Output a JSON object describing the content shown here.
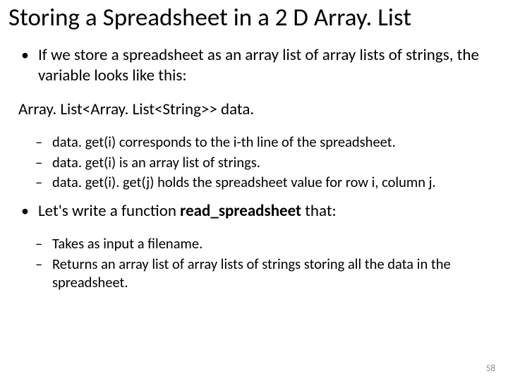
{
  "title": "Storing a Spreadsheet in a 2 D Array. List",
  "bullet1": "If we store a spreadsheet as an array list of array lists of strings, the variable looks like this:",
  "code_line": "Array. List<Array. List<String>> data.",
  "sub1": {
    "a": "data. get(i) corresponds to the i-th line of the spreadsheet.",
    "b": "data. get(i) is an array list of strings.",
    "c": "data. get(i). get(j) holds the spreadsheet value for row i, column j."
  },
  "bullet2_pre": "Let's write a function ",
  "bullet2_bold": "read_spreadsheet",
  "bullet2_post": " that:",
  "sub2": {
    "a": "Takes as input a filename.",
    "b": "Returns an array list of array lists of strings storing all the data in the spreadsheet."
  },
  "page_number": "58"
}
